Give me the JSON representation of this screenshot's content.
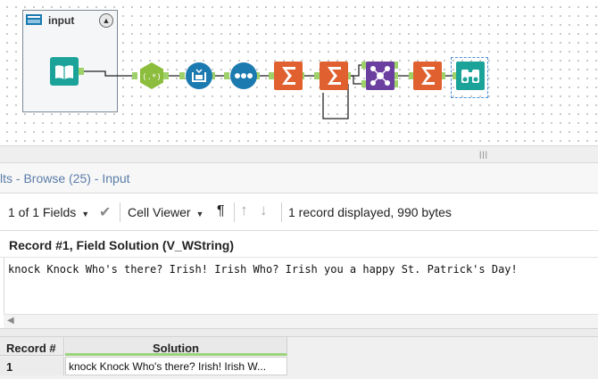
{
  "canvas": {
    "container_title": "input",
    "collapse_icon": "chevron-up-icon",
    "tools": [
      {
        "name": "input-data-tool",
        "icon": "book-icon",
        "color": "#1ba39a"
      },
      {
        "name": "regex-tool",
        "icon": "regex-icon",
        "label": "(.*)",
        "color": "#8cbd3c"
      },
      {
        "name": "multi-row-formula-tool",
        "icon": "multi-row-icon",
        "color": "#1b7ab0"
      },
      {
        "name": "sample-tool",
        "icon": "sample-icon",
        "color": "#1b7ab0"
      },
      {
        "name": "summarize-tool-1",
        "icon": "sigma-icon",
        "color": "#e0612f"
      },
      {
        "name": "summarize-tool-2",
        "icon": "sigma-icon",
        "color": "#e0612f"
      },
      {
        "name": "join-tool",
        "icon": "join-icon",
        "color": "#6b3fa0"
      },
      {
        "name": "summarize-tool-3",
        "icon": "sigma-icon",
        "color": "#e0612f"
      },
      {
        "name": "browse-tool",
        "icon": "binoculars-icon",
        "color": "#1ba39a"
      }
    ]
  },
  "results": {
    "title": "lts - Browse (25) - Input"
  },
  "toolbar": {
    "fields_label": "1 of 1 Fields",
    "viewer_label": "Cell Viewer",
    "paragraph_symbol": "¶",
    "status": "1 record displayed, 990 bytes"
  },
  "record": {
    "header": "Record #1, Field Solution (V_WString)",
    "cell_text": "knock Knock Who's there? Irish! Irish Who? Irish you a happy St. Patrick's Day!"
  },
  "table": {
    "headers": [
      "Record #",
      "Solution"
    ],
    "rows": [
      {
        "record": "1",
        "solution": "knock Knock Who's there? Irish! Irish W..."
      }
    ]
  }
}
